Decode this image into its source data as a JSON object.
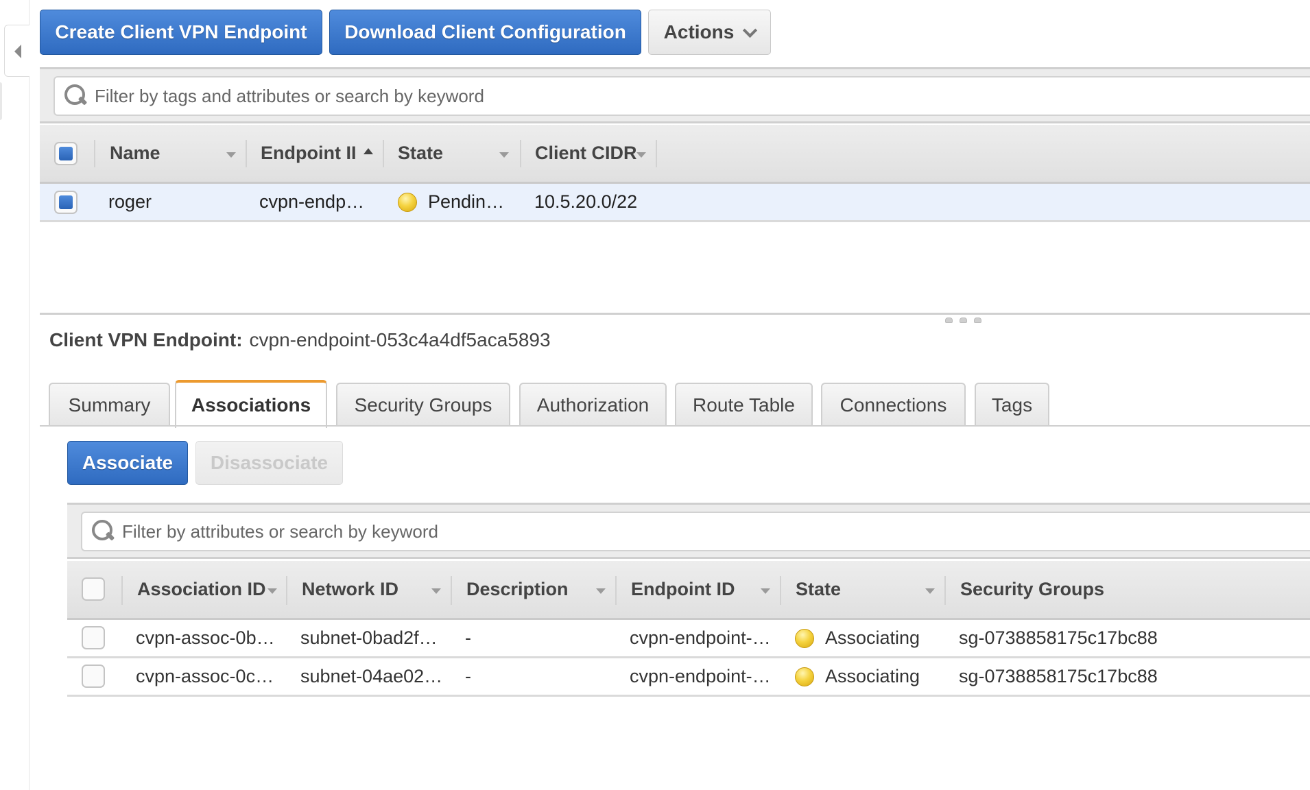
{
  "toolbar": {
    "create_label": "Create Client VPN Endpoint",
    "download_label": "Download Client Configuration",
    "actions_label": "Actions"
  },
  "top_filter": {
    "placeholder": "Filter by tags and attributes or search by keyword",
    "value": ""
  },
  "endpoints_table": {
    "columns": [
      "Name",
      "Endpoint ID",
      "State",
      "Client CIDR"
    ],
    "header_display": [
      "Name",
      "Endpoint II",
      "State",
      "Client CIDR"
    ],
    "sorted_column": "Endpoint ID",
    "sort_direction": "ascending",
    "rows": [
      {
        "selected": true,
        "name": "roger",
        "endpoint_id": "cvpn-endp…",
        "state": "Pendin…",
        "state_color": "#f5d340",
        "client_cidr": "10.5.20.0/22"
      }
    ]
  },
  "detail": {
    "label": "Client VPN Endpoint:",
    "endpoint_id": "cvpn-endpoint-053c4a4df5aca5893",
    "tabs": [
      {
        "label": "Summary",
        "active": false
      },
      {
        "label": "Associations",
        "active": true
      },
      {
        "label": "Security Groups",
        "active": false
      },
      {
        "label": "Authorization",
        "active": false
      },
      {
        "label": "Route Table",
        "active": false
      },
      {
        "label": "Connections",
        "active": false
      },
      {
        "label": "Tags",
        "active": false
      }
    ],
    "associate_label": "Associate",
    "disassociate_label": "Disassociate",
    "filter": {
      "placeholder": "Filter by attributes or search by keyword",
      "value": ""
    },
    "associations_table": {
      "columns": [
        "Association ID",
        "Network ID",
        "Description",
        "Endpoint ID",
        "State",
        "Security Groups"
      ],
      "rows": [
        {
          "selected": false,
          "association_id": "cvpn-assoc-0b…",
          "network_id": "subnet-0bad2f…",
          "description": "-",
          "endpoint_id": "cvpn-endpoint-…",
          "state": "Associating",
          "security_groups": "sg-0738858175c17bc88"
        },
        {
          "selected": false,
          "association_id": "cvpn-assoc-0c…",
          "network_id": "subnet-04ae02…",
          "description": "-",
          "endpoint_id": "cvpn-endpoint-…",
          "state": "Associating",
          "security_groups": "sg-0738858175c17bc88"
        }
      ]
    }
  },
  "colors": {
    "primary_button": "#2f6bc0",
    "active_tab_accent": "#ec9a2f",
    "selected_row": "#eaf1fc",
    "status_pending": "#f5d340"
  }
}
